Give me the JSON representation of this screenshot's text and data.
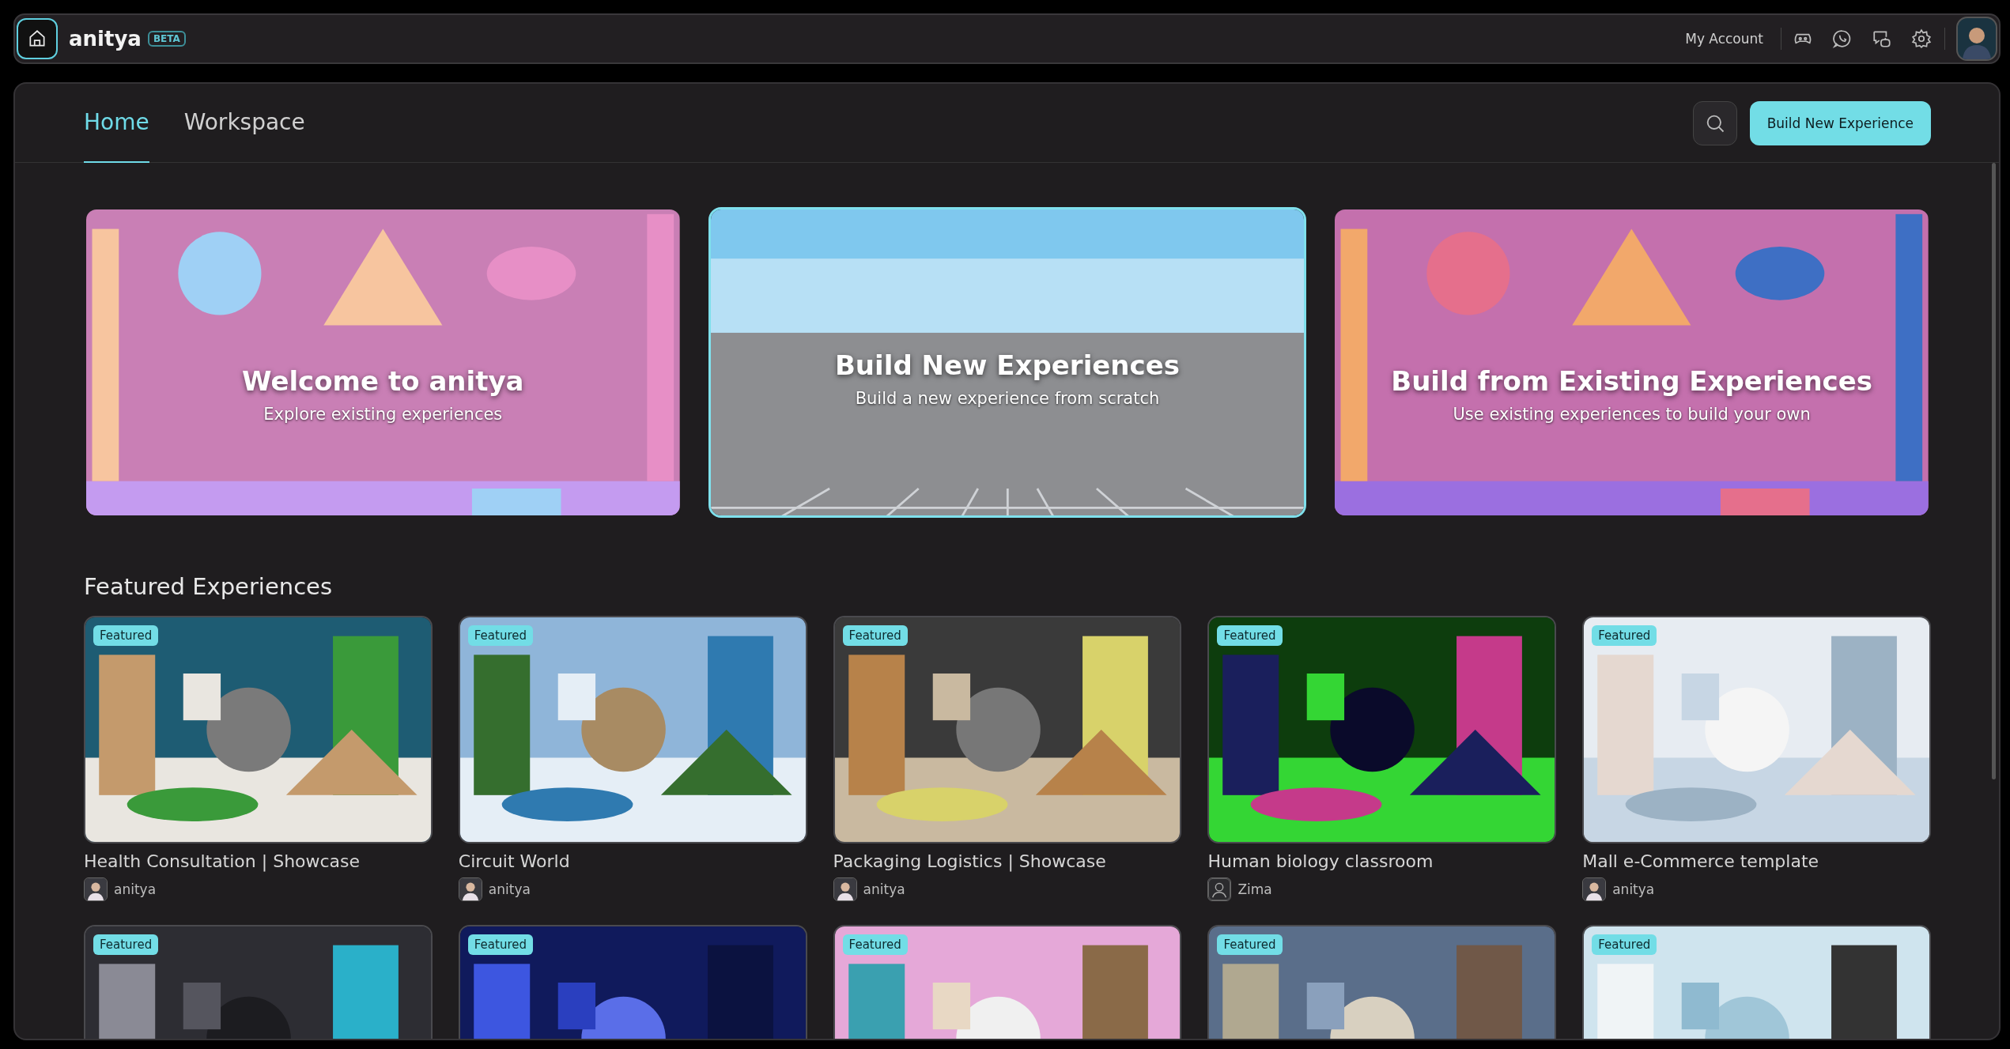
{
  "topbar": {
    "logo": "anitya",
    "badge": "BETA",
    "account_link": "My Account"
  },
  "tabs": [
    {
      "label": "Home",
      "selected": true
    },
    {
      "label": "Workspace",
      "selected": false
    }
  ],
  "build_button": "Build New Experience",
  "heroes": [
    {
      "title": "Welcome to anitya",
      "subtitle": "Explore existing experiences",
      "selected": false
    },
    {
      "title": "Build New Experiences",
      "subtitle": "Build a new experience from scratch",
      "selected": true
    },
    {
      "title": "Build from Existing Experiences",
      "subtitle": "Use existing experiences to build your own",
      "selected": false
    }
  ],
  "featured": {
    "heading": "Featured Experiences",
    "cards": [
      {
        "badge": "Featured",
        "title": "Health Consultation | Showcase",
        "author": "anitya",
        "author_has_photo": true
      },
      {
        "badge": "Featured",
        "title": "Circuit World",
        "author": "anitya",
        "author_has_photo": true
      },
      {
        "badge": "Featured",
        "title": "Packaging Logistics | Showcase",
        "author": "anitya",
        "author_has_photo": true
      },
      {
        "badge": "Featured",
        "title": "Human biology classroom",
        "author": "Zima",
        "author_has_photo": false
      },
      {
        "badge": "Featured",
        "title": "Mall e-Commerce template",
        "author": "anitya",
        "author_has_photo": true
      },
      {
        "badge": "Featured"
      },
      {
        "badge": "Featured"
      },
      {
        "badge": "Featured"
      },
      {
        "badge": "Featured"
      },
      {
        "badge": "Featured"
      }
    ]
  }
}
